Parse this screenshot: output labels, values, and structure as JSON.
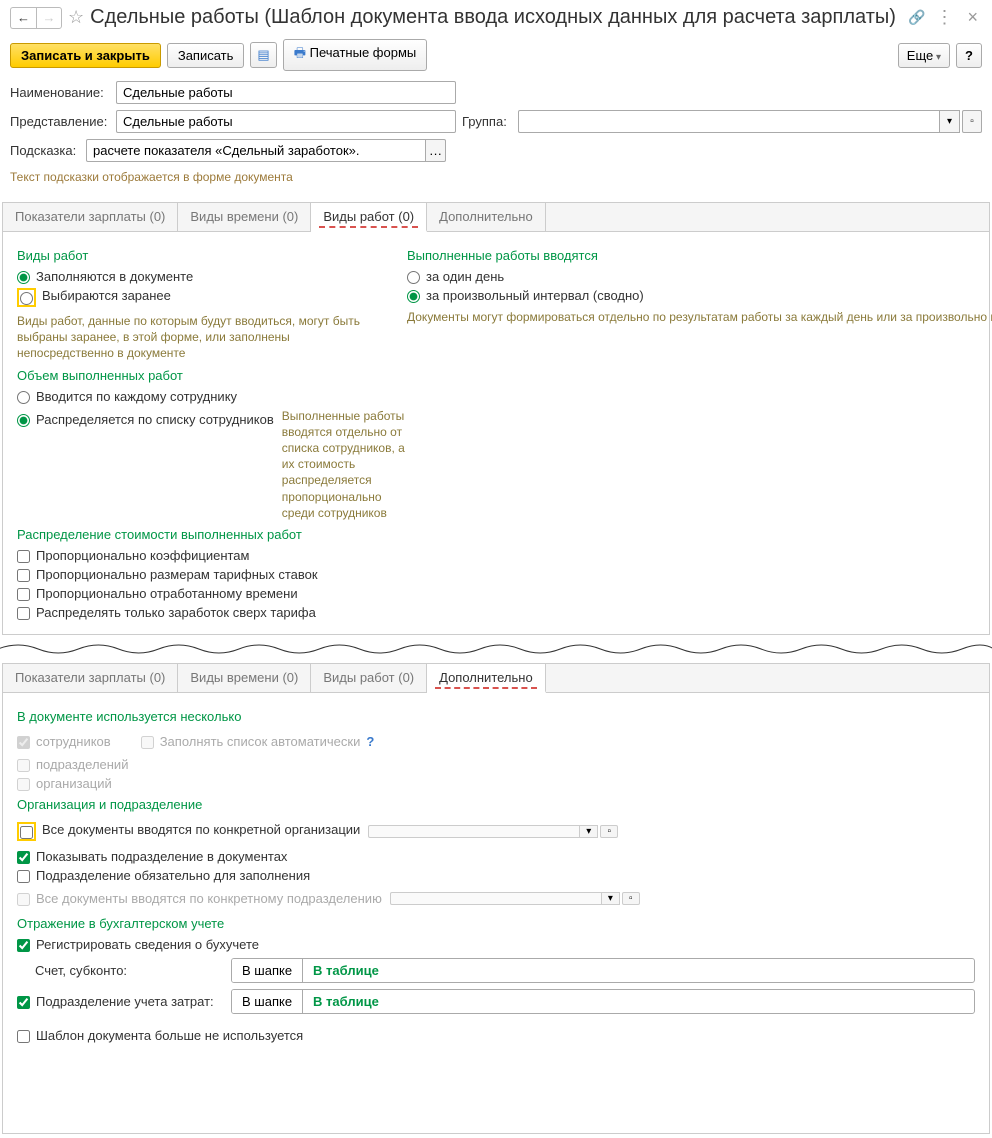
{
  "title": "Сдельные работы (Шаблон документа ввода исходных данных для расчета зарплаты)",
  "toolbar": {
    "save_close": "Записать и закрыть",
    "save": "Записать",
    "print": "Печатные формы",
    "more": "Еще",
    "help": "?"
  },
  "form": {
    "name_label": "Наименование:",
    "name_value": "Сдельные работы",
    "repr_label": "Представление:",
    "repr_value": "Сдельные работы",
    "group_label": "Группа:",
    "group_value": "",
    "hint_label": "Подсказка:",
    "hint_value": "расчете показателя «Сдельный заработок».",
    "hint_note": "Текст подсказки отображается в форме документа"
  },
  "tabs_p1": [
    "Показатели зарплаты (0)",
    "Виды времени (0)",
    "Виды работ (0)",
    "Дополнительно"
  ],
  "p1": {
    "sec_types": "Виды работ",
    "r_in_doc": "Заполняются в документе",
    "r_pre": "Выбираются заранее",
    "types_note": "Виды работ, данные по которым будут вводиться, могут быть выбраны заранее, в этой форме, или заполнены непосредственно в документе",
    "sec_done": "Выполненные работы вводятся",
    "r_one_day": "за один день",
    "r_interval": "за произвольный интервал (сводно)",
    "done_note": "Документы могут формироваться отдельно по результатам работы за каждый день или за произвольно выбранный интервал",
    "sec_volume": "Объем выполненных работ",
    "r_per_emp": "Вводится по каждому сотруднику",
    "r_by_list": "Распределяется по списку сотрудников",
    "volume_note": "Выполненные работы вводятся отдельно от списка сотрудников, а их стоимость распределяется пропорционально среди сотрудников",
    "sec_dist": "Распределение стоимости выполненных работ",
    "c_coef": "Пропорционально коэффициентам",
    "c_rates": "Пропорционально размерам тарифных ставок",
    "c_time": "Пропорционально отработанному времени",
    "c_over": "Распределять только заработок сверх тарифа"
  },
  "tabs_p2": [
    "Показатели зарплаты (0)",
    "Виды времени (0)",
    "Виды работ (0)",
    "Дополнительно"
  ],
  "p2": {
    "sec_multi": "В документе используется несколько",
    "c_emp": "сотрудников",
    "c_auto": "Заполнять список автоматически",
    "c_dept": "подразделений",
    "c_org": "организаций",
    "sec_org": "Организация и подразделение",
    "c_all_org": "Все документы вводятся по конкретной организации",
    "c_show_dept": "Показывать подразделение в документах",
    "c_dept_req": "Подразделение обязательно для заполнения",
    "c_all_dept": "Все документы вводятся по конкретному подразделению",
    "sec_acc": "Отражение в бухгалтерском учете",
    "c_reg_acc": "Регистрировать сведения о бухучете",
    "lbl_account": "Счет, субконто:",
    "c_cost_dept": "Подразделение учета затрат:",
    "t_header": "В шапке",
    "t_table": "В таблице",
    "c_not_used": "Шаблон документа больше не используется"
  }
}
